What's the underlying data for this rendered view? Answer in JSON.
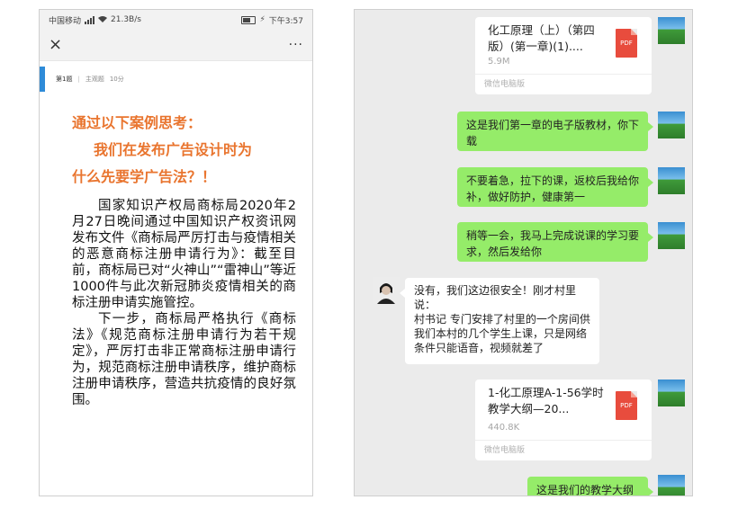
{
  "status": {
    "carrier": "中国移动",
    "network": "4G",
    "speed": "21.3B/s",
    "battery": "40",
    "time": "下午3:57"
  },
  "nav": {
    "close": "×",
    "more": "···"
  },
  "question": {
    "number": "第1题",
    "type": "主观题",
    "score": "10分"
  },
  "case": {
    "line1": "通过以下案例思考：",
    "line2": "我们在发布广告设计时为",
    "line3": "什么先要学广告法？！"
  },
  "body": {
    "p1": "国家知识产权局商标局2020年2月27日晚间通过中国知识产权资讯网发布文件《商标局严厉打击与疫情相关的恶意商标注册申请行为》：截至目前，商标局已对“火神山”“雷神山”等近1000件与此次新冠肺炎疫情相关的商标注册申请实施管控。",
    "p2": "下一步，商标局严格执行《商标法》《规范商标注册申请行为若干规定》，严厉打击非正常商标注册申请行为，规范商标注册申请秩序，维护商标注册申请秩序，营造共抗疫情的良好氛围。"
  },
  "chat": {
    "file1": {
      "name": "化工原理（上）（第四版）(第一章)(1)....",
      "size": "5.9M",
      "type": "PDF",
      "source": "微信电脑版"
    },
    "msg1": "这是我们第一章的电子版教材，你下载",
    "msg2": "不要着急，拉下的课，返校后我给你补，做好防护，健康第一",
    "msg3": "稍等一会，我马上完成说课的学习要求，然后发给你",
    "reply": "没有，我们这边很安全！刚才村里说：\n村书记 专门安排了村里的一个房间供我们本村的几个学生上课，只是网络条件只能语音，视频就差了",
    "file2": {
      "name": "1-化工原理A-1-56学时教学大纲—20...",
      "size": "440.8K",
      "type": "PDF",
      "source": "微信电脑版"
    },
    "msg4": "这是我们的教学大纲"
  }
}
